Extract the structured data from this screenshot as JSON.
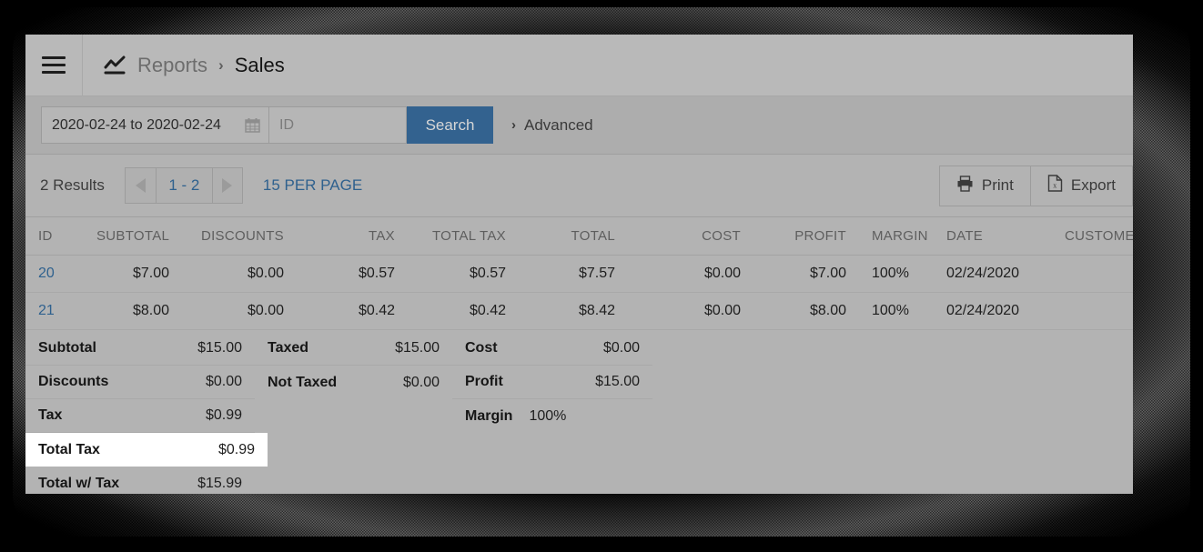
{
  "header": {
    "menu_icon": "hamburger-icon",
    "breadcrumb_icon": "line-chart-icon",
    "breadcrumb_parent": "Reports",
    "breadcrumb_separator": "›",
    "breadcrumb_current": "Sales"
  },
  "search": {
    "date_range_value": "2020-02-24 to 2020-02-24",
    "calendar_icon": "calendar-icon",
    "id_placeholder": "ID",
    "id_value": "",
    "search_button": "Search",
    "advanced_chevron": "›",
    "advanced_label": "Advanced"
  },
  "toolbar": {
    "results_count": "2 Results",
    "prev_icon": "triangle-left-icon",
    "page_range": "1 - 2",
    "next_icon": "triangle-right-icon",
    "per_page": "15 PER PAGE",
    "print_icon": "printer-icon",
    "print_label": "Print",
    "export_icon": "excel-file-icon",
    "export_label": "Export"
  },
  "table": {
    "columns": [
      "ID",
      "SUBTOTAL",
      "DISCOUNTS",
      "TAX",
      "TOTAL TAX",
      "TOTAL",
      "COST",
      "PROFIT",
      "MARGIN",
      "DATE",
      "CUSTOMER"
    ],
    "rows": [
      {
        "id": "20",
        "subtotal": "$7.00",
        "discounts": "$0.00",
        "tax": "$0.57",
        "total_tax": "$0.57",
        "total": "$7.57",
        "cost": "$0.00",
        "profit": "$7.00",
        "margin": "100%",
        "date": "02/24/2020",
        "customer": ""
      },
      {
        "id": "21",
        "subtotal": "$8.00",
        "discounts": "$0.00",
        "tax": "$0.42",
        "total_tax": "$0.42",
        "total": "$8.42",
        "cost": "$0.00",
        "profit": "$8.00",
        "margin": "100%",
        "date": "02/24/2020",
        "customer": ""
      }
    ]
  },
  "summary": {
    "col1": [
      {
        "label": "Subtotal",
        "value": "$15.00"
      },
      {
        "label": "Discounts",
        "value": "$0.00"
      },
      {
        "label": "Tax",
        "value": "$0.99"
      },
      {
        "label": "Total Tax",
        "value": "$0.99"
      },
      {
        "label": "Total w/ Tax",
        "value": "$15.99"
      }
    ],
    "col2": [
      {
        "label": "Taxed",
        "value": "$15.00"
      },
      {
        "label": "Not Taxed",
        "value": "$0.00"
      }
    ],
    "col3": [
      {
        "label": "Cost",
        "value": "$0.00"
      },
      {
        "label": "Profit",
        "value": "$15.00"
      },
      {
        "label": "Margin",
        "value": "100%"
      }
    ]
  },
  "colors": {
    "accent_blue": "#2f618e",
    "search_button": "#33628f",
    "panel_bg": "#b3b3b3",
    "header_bg": "#b9b9b9",
    "searchbar_bg": "#adadad",
    "highlight": "#ffffff"
  }
}
